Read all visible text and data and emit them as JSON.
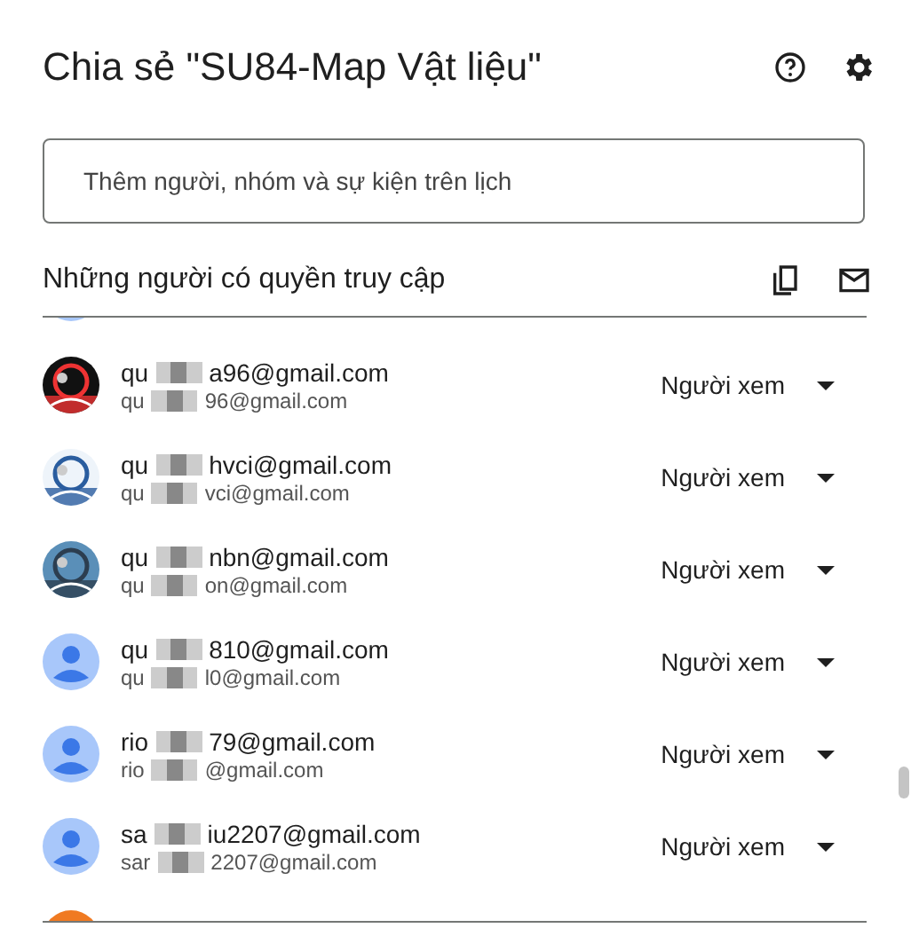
{
  "dialog": {
    "title": "Chia sẻ \"SU84-Map Vật liệu\""
  },
  "search": {
    "placeholder": "Thêm người, nhóm và sự kiện trên lịch"
  },
  "access_section": {
    "title": "Những người có quyền truy cập"
  },
  "people": [
    {
      "kind": "default"
    },
    {
      "name_start": "qu",
      "name_end": "a96@gmail.com",
      "email_start": "qu",
      "email_end": "96@gmail.com",
      "role": "Người xem"
    },
    {
      "name_start": "qu",
      "name_end": "hvci@gmail.com",
      "email_start": "qu",
      "email_end": "vci@gmail.com",
      "role": "Người xem"
    },
    {
      "name_start": "qu",
      "name_end": "nbn@gmail.com",
      "email_start": "qu",
      "email_end": "on@gmail.com",
      "role": "Người xem"
    },
    {
      "kind": "default",
      "name_start": "qu",
      "name_end": "810@gmail.com",
      "email_start": "qu",
      "email_end": "l0@gmail.com",
      "role": "Người xem"
    },
    {
      "kind": "default",
      "name_start": "rio",
      "name_end": "79@gmail.com",
      "email_start": "rio",
      "email_end": "@gmail.com",
      "role": "Người xem"
    },
    {
      "kind": "default",
      "name_start": "sa",
      "name_end": "iu2207@gmail.com",
      "email_start": "sar",
      "email_end": "2207@gmail.com",
      "role": "Người xem"
    },
    {
      "kind": "letter"
    }
  ]
}
